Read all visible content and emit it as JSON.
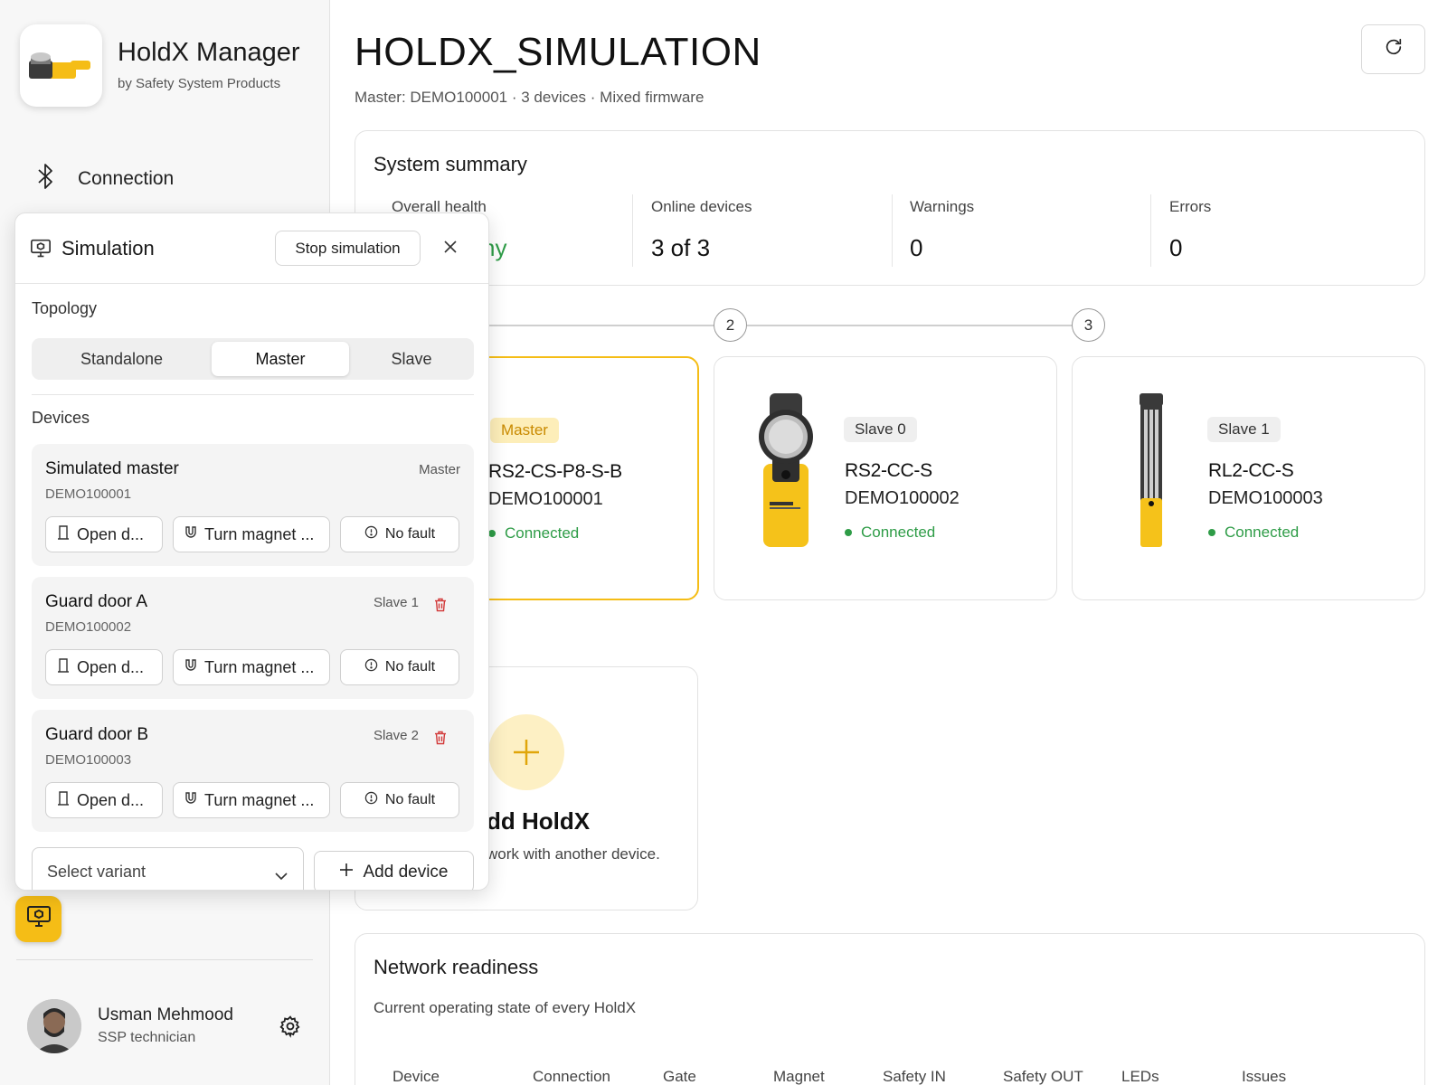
{
  "sidebar": {
    "app_title": "HoldX Manager",
    "app_subtitle": "by Safety System Products",
    "nav": [
      {
        "label": "Connection",
        "icon": "bluetooth-icon"
      }
    ],
    "user": {
      "name": "Usman Mehmood",
      "role": "SSP technician"
    }
  },
  "header": {
    "title": "HOLDX_SIMULATION",
    "subtitle": "Master: DEMO100001 · 3 devices · Mixed firmware"
  },
  "summary": {
    "title": "System summary",
    "stats": [
      {
        "label": "Overall health",
        "value": "ny"
      },
      {
        "label": "Online devices",
        "value": "3 of 3"
      },
      {
        "label": "Warnings",
        "value": "0"
      },
      {
        "label": "Errors",
        "value": "0"
      }
    ]
  },
  "chain": {
    "nodes": [
      "2",
      "3"
    ]
  },
  "devices": [
    {
      "role": "Master",
      "model": "RS2-CS-P8-S-B",
      "serial": "DEMO100001",
      "status": "Connected"
    },
    {
      "role": "Slave 0",
      "model": "RS2-CC-S",
      "serial": "DEMO100002",
      "status": "Connected"
    },
    {
      "role": "Slave 1",
      "model": "RL2-CC-S",
      "serial": "DEMO100003",
      "status": "Connected"
    }
  ],
  "add_card": {
    "title": "dd HoldX",
    "desc": "work with another device."
  },
  "network": {
    "title": "Network readiness",
    "subtitle": "Current operating state of every HoldX",
    "columns": [
      "Device",
      "Connection",
      "Gate",
      "Magnet",
      "Safety IN",
      "Safety OUT",
      "LEDs",
      "Issues"
    ]
  },
  "simulation": {
    "title": "Simulation",
    "stop_label": "Stop simulation",
    "topology_label": "Topology",
    "topology_options": [
      "Standalone",
      "Master",
      "Slave"
    ],
    "topology_selected": "Master",
    "devices_label": "Devices",
    "devices": [
      {
        "name": "Simulated master",
        "serial": "DEMO100001",
        "role": "Master",
        "open": "Open d...",
        "magnet": "Turn magnet ...",
        "fault": "No fault"
      },
      {
        "name": "Guard door A",
        "serial": "DEMO100002",
        "role": "Slave 1",
        "open": "Open d...",
        "magnet": "Turn magnet ...",
        "fault": "No fault"
      },
      {
        "name": "Guard door B",
        "serial": "DEMO100003",
        "role": "Slave 2",
        "open": "Open d...",
        "magnet": "Turn magnet ...",
        "fault": "No fault"
      }
    ],
    "variant_placeholder": "Select variant",
    "add_device_label": "Add device"
  },
  "colors": {
    "accent": "#f5bd16",
    "success": "#2e9c47",
    "danger": "#d23a3a"
  }
}
